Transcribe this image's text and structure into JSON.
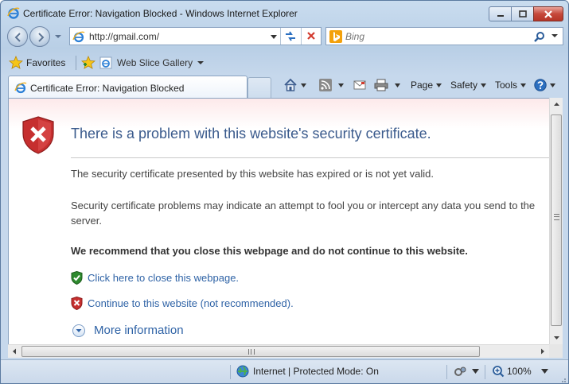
{
  "window": {
    "title": "Certificate Error: Navigation Blocked - Windows Internet Explorer",
    "app_icon": "ie-logo-icon"
  },
  "nav": {
    "address_value": "http://gmail.com/",
    "search_placeholder": "Bing"
  },
  "favorites_bar": {
    "favorites_label": "Favorites",
    "web_slice_label": "Web Slice Gallery"
  },
  "tab": {
    "label": "Certificate Error: Navigation Blocked"
  },
  "command_bar": {
    "page_label": "Page",
    "safety_label": "Safety",
    "tools_label": "Tools"
  },
  "content": {
    "title": "There is a problem with this website's security certificate.",
    "p1": "The security certificate presented by this website has expired or is not yet valid.",
    "p2": "Security certificate problems may indicate an attempt to fool you or intercept any data you send to the server.",
    "recommendation": "We recommend that you close this webpage and do not continue to this website.",
    "close_link": "Click here to close this webpage.",
    "continue_link": "Continue to this website (not recommended).",
    "more_info": "More information"
  },
  "status_bar": {
    "zone_text": "Internet | Protected Mode: On",
    "zoom_text": "100%"
  },
  "colors": {
    "link": "#2f63a6",
    "title": "#3a5a8c",
    "error_red": "#c62f2f",
    "safe_green": "#2e8a2e"
  }
}
